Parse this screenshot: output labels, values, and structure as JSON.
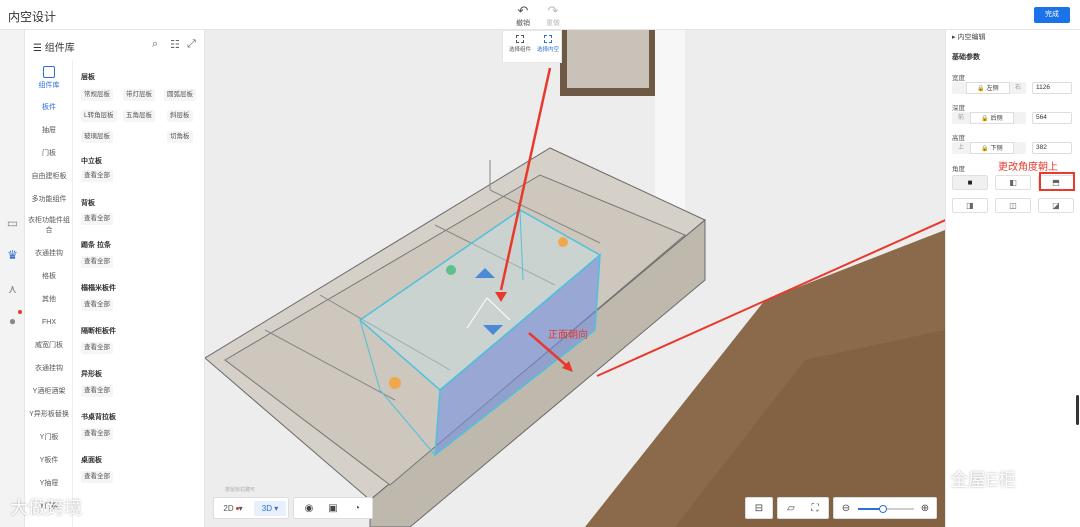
{
  "app": {
    "title": "内空设计",
    "done_label": "完成"
  },
  "top_tools": [
    {
      "icon": "undo-icon",
      "glyph": "↶",
      "label": "撤销"
    },
    {
      "icon": "redo-icon",
      "glyph": "↷",
      "label": "重做"
    }
  ],
  "rail": {
    "icons": [
      "cabinet-icon",
      "crown-icon",
      "tree-icon",
      "user-icon"
    ]
  },
  "library": {
    "title": "组件库",
    "main_category": "组件库",
    "categories": [
      "板件",
      "抽屉",
      "门板",
      "自由建柜板",
      "多功能组件",
      "衣柜功能件组合",
      "衣通挂钩",
      "格板",
      "其他",
      "FHX",
      "威宽门板",
      "衣通挂钩",
      "Y酒柜酒架",
      "Y异形板替换",
      "Y门板",
      "Y板件",
      "Y抽屉",
      "Y门板"
    ],
    "sections": [
      {
        "title": "层板",
        "items": [
          "常规层板",
          "带灯层板",
          "圆弧层板",
          "L转角层板",
          "五角层板",
          "斜层板",
          "玻璃层板",
          "切角板"
        ]
      },
      {
        "title": "中立板",
        "items": [
          "查看全部"
        ]
      },
      {
        "title": "背板",
        "items": [
          "查看全部"
        ]
      },
      {
        "title": "踢条 拉条",
        "items": [
          "查看全部"
        ]
      },
      {
        "title": "榻榻米板件",
        "items": [
          "查看全部"
        ]
      },
      {
        "title": "隔断柜板件",
        "items": [
          "查看全部"
        ]
      },
      {
        "title": "异形板",
        "items": [
          "查看全部"
        ]
      },
      {
        "title": "书桌背拉板",
        "items": [
          "查看全部"
        ]
      },
      {
        "title": "桌面板",
        "items": [
          "查看全部"
        ]
      }
    ]
  },
  "viewport": {
    "mini_tools": [
      {
        "label": "选择组件",
        "active": false
      },
      {
        "label": "选择内空",
        "active": true
      }
    ],
    "annotation_front": "正面朝向",
    "annotation_angle": "更改角度朝上",
    "hint_text": "按鼠标右键可"
  },
  "bottom": {
    "view_2d": "2D",
    "view_3d": "3D",
    "view_icons": [
      "eye-icon",
      "cube-icon",
      "compass-icon"
    ],
    "right_icons": [
      "measure-icon",
      "camera-icon",
      "fit-icon"
    ],
    "zoom_out": "zoom-out-icon",
    "zoom_in": "zoom-in-icon",
    "zoom_level": 0.45
  },
  "props": {
    "title": "内空编辑",
    "subtitle": "基础参数",
    "fields": [
      {
        "label": "宽度",
        "opts": [
          "",
          "左侧",
          "右"
        ],
        "active": 1,
        "value": "1126"
      },
      {
        "label": "深度",
        "opts": [
          "前",
          "后侧",
          ""
        ],
        "active": 1,
        "value": "564"
      },
      {
        "label": "高度",
        "opts": [
          "上",
          "下侧",
          ""
        ],
        "active": 1,
        "value": "382"
      }
    ],
    "angle_label": "角度",
    "angle_buttons": [
      "■",
      "◧",
      "⬒",
      "◨",
      "◫",
      "◪"
    ]
  },
  "watermark": {
    "left": "大做跨境",
    "right": "全屋E柜"
  },
  "colors": {
    "accent": "#1a73e8",
    "annotation": "#e8392c",
    "selection": "#5ec6e0"
  }
}
